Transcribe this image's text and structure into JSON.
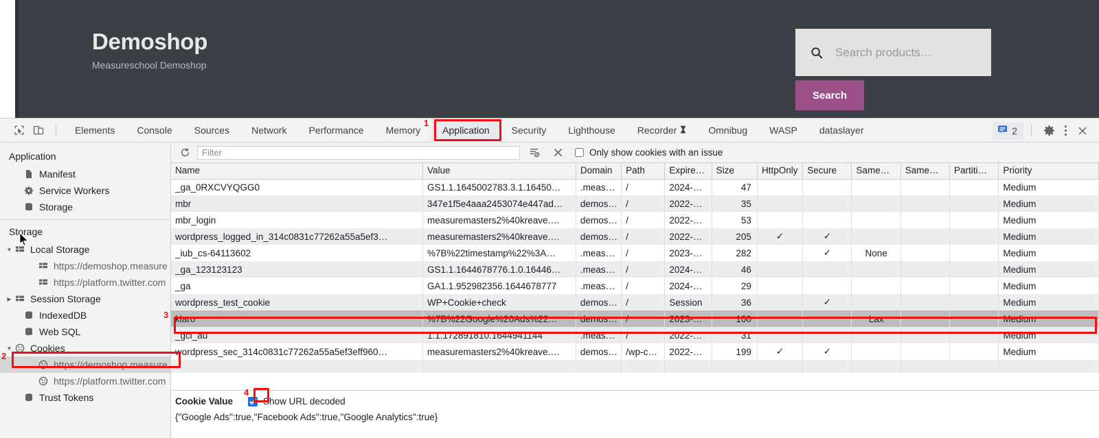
{
  "site": {
    "title": "Demoshop",
    "subtitle": "Measureschool Demoshop",
    "search_placeholder": "Search products…",
    "search_value": "",
    "search_button": "Search",
    "header_bg": "#3b3f46",
    "accent": "#9b4f87"
  },
  "devtools": {
    "tabs": [
      {
        "label": "Elements",
        "active": false
      },
      {
        "label": "Console",
        "active": false
      },
      {
        "label": "Sources",
        "active": false
      },
      {
        "label": "Network",
        "active": false
      },
      {
        "label": "Performance",
        "active": false
      },
      {
        "label": "Memory",
        "active": false
      },
      {
        "label": "Application",
        "active": true
      },
      {
        "label": "Security",
        "active": false
      },
      {
        "label": "Lighthouse",
        "active": false
      },
      {
        "label": "Recorder",
        "active": false,
        "suffix": "icon"
      },
      {
        "label": "Omnibug",
        "active": false
      },
      {
        "label": "WASP",
        "active": false
      },
      {
        "label": "dataslayer",
        "active": false
      }
    ],
    "issues_count": "2",
    "icons": {
      "inspect": "inspect-element-icon",
      "device": "device-toolbar-icon",
      "issues": "issues-badge-icon",
      "settings": "gear-icon",
      "more": "kebab-menu-icon",
      "close": "close-icon"
    }
  },
  "sidebar": {
    "groups": [
      {
        "title": "Application",
        "items": [
          {
            "label": "Manifest",
            "icon": "document-icon",
            "indent": 1,
            "arrow": "none",
            "selected": false
          },
          {
            "label": "Service Workers",
            "icon": "gear-icon",
            "indent": 1,
            "arrow": "none",
            "selected": false
          },
          {
            "label": "Storage",
            "icon": "database-icon",
            "indent": 1,
            "arrow": "none",
            "selected": false
          }
        ]
      },
      {
        "title": "Storage",
        "items": [
          {
            "label": "Local Storage",
            "icon": "table-icon",
            "indent": 0,
            "arrow": "expanded",
            "selected": false
          },
          {
            "label": "https://demoshop.measure",
            "icon": "table-icon",
            "indent": 2,
            "arrow": "none",
            "selected": false
          },
          {
            "label": "https://platform.twitter.com",
            "icon": "table-icon",
            "indent": 2,
            "arrow": "none",
            "selected": false
          },
          {
            "label": "Session Storage",
            "icon": "table-icon",
            "indent": 0,
            "arrow": "collapsed",
            "selected": false
          },
          {
            "label": "IndexedDB",
            "icon": "database-icon",
            "indent": 1,
            "arrow": "none",
            "selected": false
          },
          {
            "label": "Web SQL",
            "icon": "database-icon",
            "indent": 1,
            "arrow": "none",
            "selected": false
          },
          {
            "label": "Cookies",
            "icon": "cookie-icon",
            "indent": 0,
            "arrow": "expanded",
            "selected": false
          },
          {
            "label": "https://demoshop.measure",
            "icon": "cookie-icon",
            "indent": 2,
            "arrow": "none",
            "selected": true
          },
          {
            "label": "https://platform.twitter.com",
            "icon": "cookie-icon",
            "indent": 2,
            "arrow": "none",
            "selected": false
          },
          {
            "label": "Trust Tokens",
            "icon": "database-icon",
            "indent": 1,
            "arrow": "none",
            "selected": false
          }
        ]
      }
    ]
  },
  "filter_bar": {
    "refresh_icon": "refresh-icon",
    "filter_placeholder": "Filter",
    "filter_value": "",
    "clear_filtered_icon": "clear-filtered-icon",
    "clear_all_icon": "clear-all-cookies-icon",
    "issue_checkbox_label": "Only show cookies with an issue",
    "issue_checkbox_checked": false
  },
  "table": {
    "columns": [
      "Name",
      "Value",
      "Domain",
      "Path",
      "Expire…",
      "Size",
      "HttpOnly",
      "Secure",
      "Same…",
      "Same…",
      "Partiti…",
      "Priority"
    ],
    "rows": [
      {
        "name": "_ga_0RXCVYQGG0",
        "value": "GS1.1.1645002783.3.1.16450…",
        "domain": ".meas…",
        "path": "/",
        "expires": "2024-…",
        "size": "47",
        "httponly": "",
        "secure": "",
        "samesite": "",
        "sameparty": "",
        "partition": "",
        "priority": "Medium",
        "selected": false
      },
      {
        "name": "mbr",
        "value": "347e1f5e4aaa2453074e447ad…",
        "domain": "demos…",
        "path": "/",
        "expires": "2022-…",
        "size": "35",
        "httponly": "",
        "secure": "",
        "samesite": "",
        "sameparty": "",
        "partition": "",
        "priority": "Medium",
        "selected": false
      },
      {
        "name": "mbr_login",
        "value": "measuremasters2%40kreave.…",
        "domain": "demos…",
        "path": "/",
        "expires": "2022-…",
        "size": "53",
        "httponly": "",
        "secure": "",
        "samesite": "",
        "sameparty": "",
        "partition": "",
        "priority": "Medium",
        "selected": false
      },
      {
        "name": "wordpress_logged_in_314c0831c77262a55a5ef3…",
        "value": "measuremasters2%40kreave.…",
        "domain": "demos…",
        "path": "/",
        "expires": "2022-…",
        "size": "205",
        "httponly": "✓",
        "secure": "✓",
        "samesite": "",
        "sameparty": "",
        "partition": "",
        "priority": "Medium",
        "selected": false
      },
      {
        "name": "_iub_cs-64113602",
        "value": "%7B%22timestamp%22%3A…",
        "domain": ".meas…",
        "path": "/",
        "expires": "2023-…",
        "size": "282",
        "httponly": "",
        "secure": "✓",
        "samesite": "None",
        "sameparty": "",
        "partition": "",
        "priority": "Medium",
        "selected": false
      },
      {
        "name": "_ga_123123123",
        "value": "GS1.1.1644678776.1.0.16446…",
        "domain": ".meas…",
        "path": "/",
        "expires": "2024-…",
        "size": "46",
        "httponly": "",
        "secure": "",
        "samesite": "",
        "sameparty": "",
        "partition": "",
        "priority": "Medium",
        "selected": false
      },
      {
        "name": "_ga",
        "value": "GA1.1.952982356.1644678777",
        "domain": ".meas…",
        "path": "/",
        "expires": "2024-…",
        "size": "29",
        "httponly": "",
        "secure": "",
        "samesite": "",
        "sameparty": "",
        "partition": "",
        "priority": "Medium",
        "selected": false
      },
      {
        "name": "wordpress_test_cookie",
        "value": "WP+Cookie+check",
        "domain": "demos…",
        "path": "/",
        "expires": "Session",
        "size": "36",
        "httponly": "",
        "secure": "✓",
        "samesite": "",
        "sameparty": "",
        "partition": "",
        "priority": "Medium",
        "selected": false
      },
      {
        "name": "klaro",
        "value": "%7B%22Google%20Ads%22…",
        "domain": "demos…",
        "path": "/",
        "expires": "2023-…",
        "size": "100",
        "httponly": "",
        "secure": "",
        "samesite": "Lax",
        "sameparty": "",
        "partition": "",
        "priority": "Medium",
        "selected": true
      },
      {
        "name": "_gcl_au",
        "value": "1.1.172891810.1644941144",
        "domain": ".meas…",
        "path": "/",
        "expires": "2022-…",
        "size": "31",
        "httponly": "",
        "secure": "",
        "samesite": "",
        "sameparty": "",
        "partition": "",
        "priority": "Medium",
        "selected": false
      },
      {
        "name": "wordpress_sec_314c0831c77262a55a5ef3eff960…",
        "value": "measuremasters2%40kreave.…",
        "domain": "demos…",
        "path": "/wp-c…",
        "expires": "2022-…",
        "size": "199",
        "httponly": "✓",
        "secure": "✓",
        "samesite": "",
        "sameparty": "",
        "partition": "",
        "priority": "Medium",
        "selected": false
      }
    ]
  },
  "cookie_value_panel": {
    "title": "Cookie Value",
    "show_url_decoded_label": "Show URL decoded",
    "show_url_decoded_checked": true,
    "value": "{\"Google Ads\":true,\"Facebook Ads\":true,\"Google Analytics\":true}"
  },
  "annotations": [
    {
      "number": "1",
      "target": "application-tab"
    },
    {
      "number": "2",
      "target": "cookies-sidebar-item"
    },
    {
      "number": "3",
      "target": "klaro-row"
    },
    {
      "number": "4",
      "target": "show-url-decoded-checkbox"
    }
  ]
}
